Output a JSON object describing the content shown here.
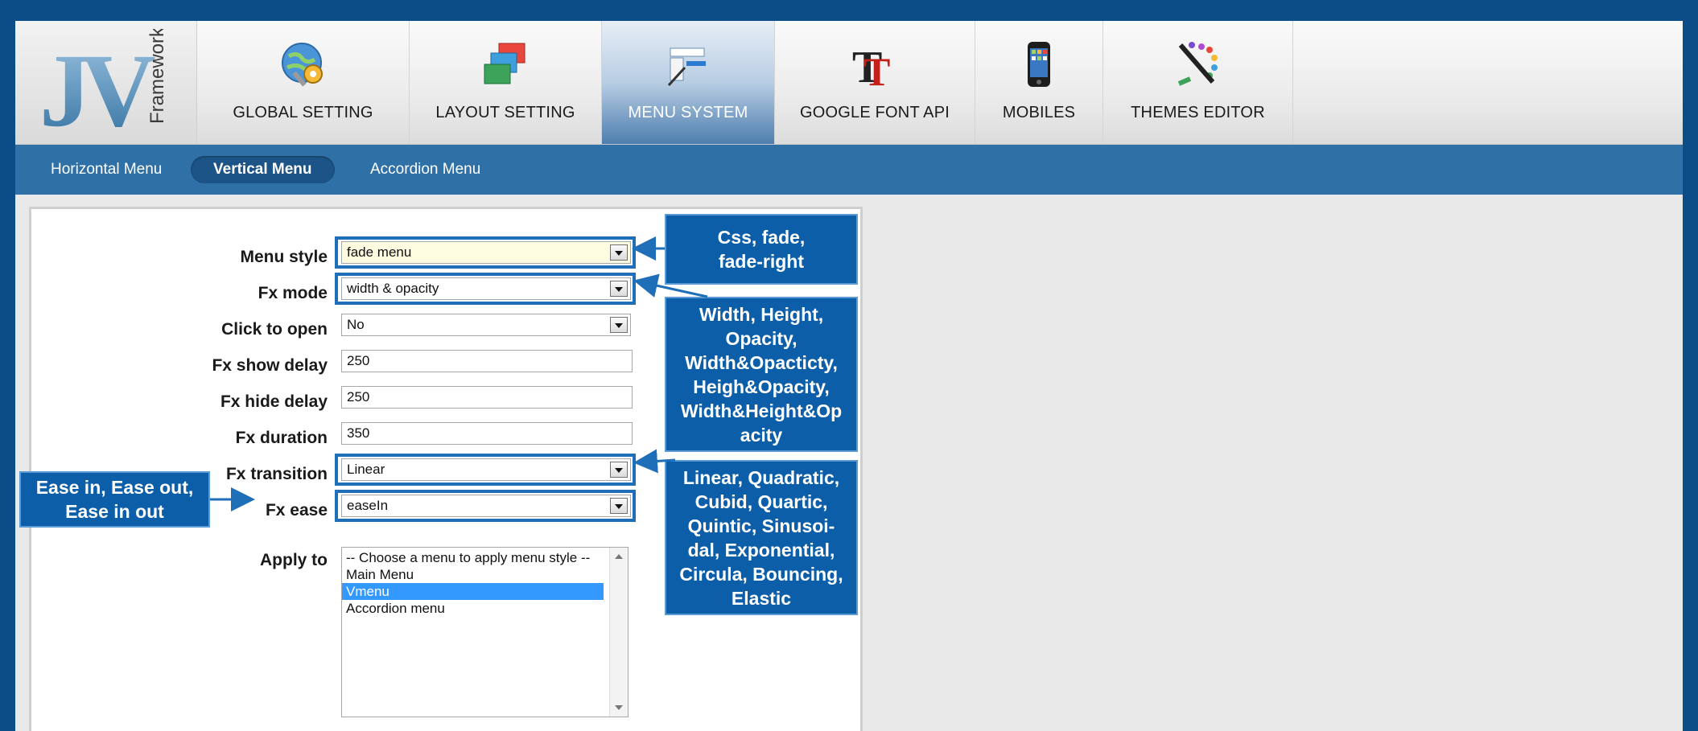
{
  "logo": {
    "letters": "JV",
    "word": "Framework"
  },
  "tabs": [
    {
      "label": "GLOBAL SETTING",
      "icon": "globe-settings-icon"
    },
    {
      "label": "LAYOUT SETTING",
      "icon": "layers-icon"
    },
    {
      "label": "MENU SYSTEM",
      "icon": "menu-system-icon",
      "active": true
    },
    {
      "label": "GOOGLE FONT API",
      "icon": "font-icon"
    },
    {
      "label": "MOBILES",
      "icon": "mobile-phone-icon"
    },
    {
      "label": "THEMES EDITOR",
      "icon": "palette-brush-icon"
    }
  ],
  "subnav": [
    {
      "label": "Horizontal Menu"
    },
    {
      "label": "Vertical Menu",
      "active": true
    },
    {
      "label": "Accordion Menu"
    }
  ],
  "form": {
    "menu_style": {
      "label": "Menu style",
      "value": "fade menu"
    },
    "fx_mode": {
      "label": "Fx mode",
      "value": "width & opacity"
    },
    "click_to_open": {
      "label": "Click to open",
      "value": "No"
    },
    "fx_show_delay": {
      "label": "Fx show delay",
      "value": "250"
    },
    "fx_hide_delay": {
      "label": "Fx hide delay",
      "value": "250"
    },
    "fx_duration": {
      "label": "Fx duration",
      "value": "350"
    },
    "fx_transition": {
      "label": "Fx transition",
      "value": "Linear"
    },
    "fx_ease": {
      "label": "Fx ease",
      "value": "easeIn"
    },
    "apply_to": {
      "label": "Apply to",
      "options": [
        "-- Choose a menu to apply menu style --",
        "Main Menu",
        "Vmenu",
        "Accordion menu"
      ],
      "selected": "Vmenu"
    }
  },
  "callouts": {
    "menu_style": "Css, fade,\nfade-right",
    "fx_mode": "Width, Height,\nOpacity,\nWidth&Opacticty,\nHeigh&Opacity,\nWidth&Height&Op\nacity",
    "fx_transition": "Linear, Quadratic,\nCubid, Quartic,\nQuintic, Sinusoi-\ndal, Exponential,\nCircula, Bouncing,\nElastic",
    "fx_ease": "Ease in, Ease out,\nEase in out"
  },
  "colors": {
    "frame": "#0b4d86",
    "subbar": "#2f70a6",
    "callout_bg": "#0d5ea8",
    "highlight_outline": "#1e6fb8",
    "selected_option": "#3399ff"
  }
}
